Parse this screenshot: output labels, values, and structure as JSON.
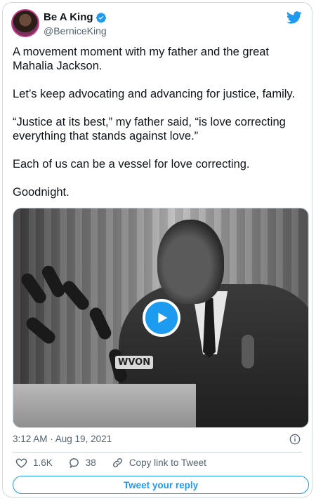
{
  "author": {
    "display_name": "Be A King",
    "handle": "@BerniceKing",
    "verified_icon": "verified-badge-icon",
    "avatar_icon": "profile-avatar"
  },
  "brand": {
    "icon": "twitter-bird-icon",
    "color": "#1d9bf0"
  },
  "tweet": {
    "paragraphs": [
      "A movement moment with my father and the great Mahalia Jackson.",
      "Let’s keep advocating and advancing for justice, family.",
      "“Justice at its best,” my father said, “is love correcting everything that stands against love.”",
      "Each of us can be a vessel for love correcting.",
      "Goodnight."
    ]
  },
  "media": {
    "type": "video",
    "play_icon": "play-icon",
    "sign_text": "WVON"
  },
  "meta": {
    "timestamp": "3:12 AM · Aug 19, 2021",
    "info_icon": "info-icon"
  },
  "actions": {
    "likes": "1.6K",
    "replies": "38",
    "copy_link": "Copy link to Tweet",
    "like_icon": "heart-icon",
    "reply_icon": "comment-icon",
    "link_icon": "link-icon"
  },
  "reply_button": {
    "label": "Tweet your reply"
  }
}
